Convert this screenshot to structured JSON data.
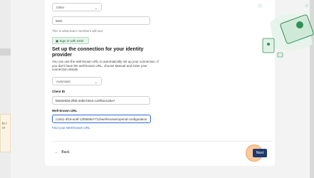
{
  "team": {
    "select_value": "Other",
    "name_value": "SSO",
    "helper_text": "This is what team members will see:",
    "sso_button_label": "Sign in with SSO"
  },
  "idp": {
    "heading": "Set up the connection for your identity provider",
    "description": "You can use the well-known URL to automatically set up your connection. If you don't have the well-known URL, choose Manual and enter your connection details.",
    "method_select": "Automatic",
    "client_id_label": "Client ID",
    "client_id_value": "b6e5e828-2f6b-4ebb-b0e2-c1ef91e125e7",
    "wellknown_label": "Well-known URL",
    "wellknown_value": "c1e51-4f18-ac9f-12f5556e7712/well-known/openid-configuration",
    "find_link": "Find your Well-known URL"
  },
  "footer": {
    "back_label": "Back",
    "next_label": "Next"
  },
  "left_note_text": "le r or",
  "colors": {
    "accent": "#2f6bd6",
    "primary_button": "#1d3a6e",
    "sso_green": "#1e6b3f",
    "highlight": "#f7a050"
  }
}
